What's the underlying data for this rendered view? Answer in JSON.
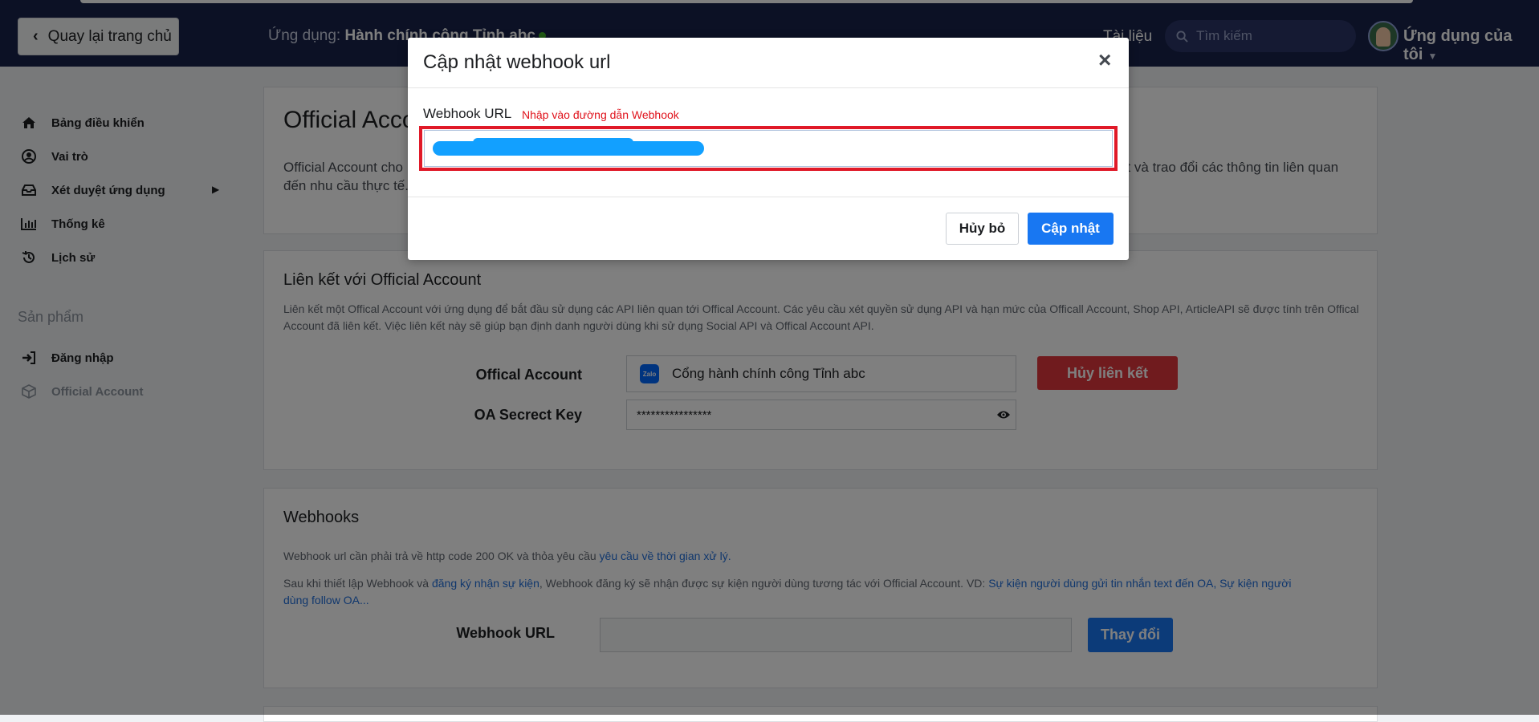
{
  "topnav": {
    "back_label": "Quay lại trang chủ",
    "app_prefix": "Ứng dụng: ",
    "app_name": "Hành chính công Tỉnh abc",
    "docs_label": "Tài liệu",
    "search_placeholder": "Tìm kiếm",
    "my_apps_label": "Ứng dụng của tôi"
  },
  "sidebar": {
    "items": [
      {
        "label": "Bảng điều khiển",
        "icon": "home-icon"
      },
      {
        "label": "Vai trò",
        "icon": "user-circle-icon"
      },
      {
        "label": "Xét duyệt ứng dụng",
        "icon": "inbox-icon"
      },
      {
        "label": "Thống kê",
        "icon": "bar-chart-icon"
      },
      {
        "label": "Lịch sử",
        "icon": "history-icon"
      }
    ],
    "section_title": "Sản phẩm",
    "products": [
      {
        "label": "Đăng nhập",
        "icon": "sign-in-icon"
      },
      {
        "label": "Official Account",
        "icon": "cube-icon"
      }
    ]
  },
  "card1": {
    "title": "Official Account",
    "desc_line1": "Official Account cho",
    "desc_line1_right": "ật và trao đổi các thông tin liên quan",
    "desc_line2": "đến nhu cầu thực tế."
  },
  "card2": {
    "title": "Liên kết với Official Account",
    "desc_line1": "Liên kết một Offical Account với ứng dụng để bắt đầu sử dụng các API liên quan tới Offical Account. Các yêu cầu xét quyền sử dụng API và hạn mức của Officall Account, Shop API, ArticleAPI sẽ được tính trên Offical",
    "desc_line2": "Account đã liên kết. Việc liên kết này sẽ giúp bạn định danh người dùng khi sử dụng Social API và Offical Account API.",
    "oa_label": "Offical Account",
    "oa_value": "Cổng hành chính công Tỉnh abc",
    "unlink_label": "Hủy liên kết",
    "secret_label": "OA Secrect Key",
    "secret_value": "****************"
  },
  "card3": {
    "title": "Webhooks",
    "line1_text": "Webhook url cần phải trả về http code 200 OK và thỏa yêu cầu ",
    "line1_link": "yêu cầu về thời gian xử lý.",
    "line2_a": "Sau khi thiết lập Webhook và ",
    "line2_link1": "đăng ký nhận sự kiện",
    "line2_b": ", Webhook đăng ký sẽ nhận được sự kiện người dùng tương tác với Official Account. VD: ",
    "line2_link2": "Sự kiện người dùng gửi tin nhắn text đến OA, Sự kiện người",
    "line3_link": "dùng follow OA...",
    "webhook_label": "Webhook URL",
    "change_label": "Thay đổi"
  },
  "modal": {
    "title": "Cập nhật webhook url",
    "close": "×",
    "field_label": "Webhook URL",
    "hint": "Nhập vào đường dẫn Webhook",
    "cancel_label": "Hủy bỏ",
    "update_label": "Cập nhật"
  }
}
